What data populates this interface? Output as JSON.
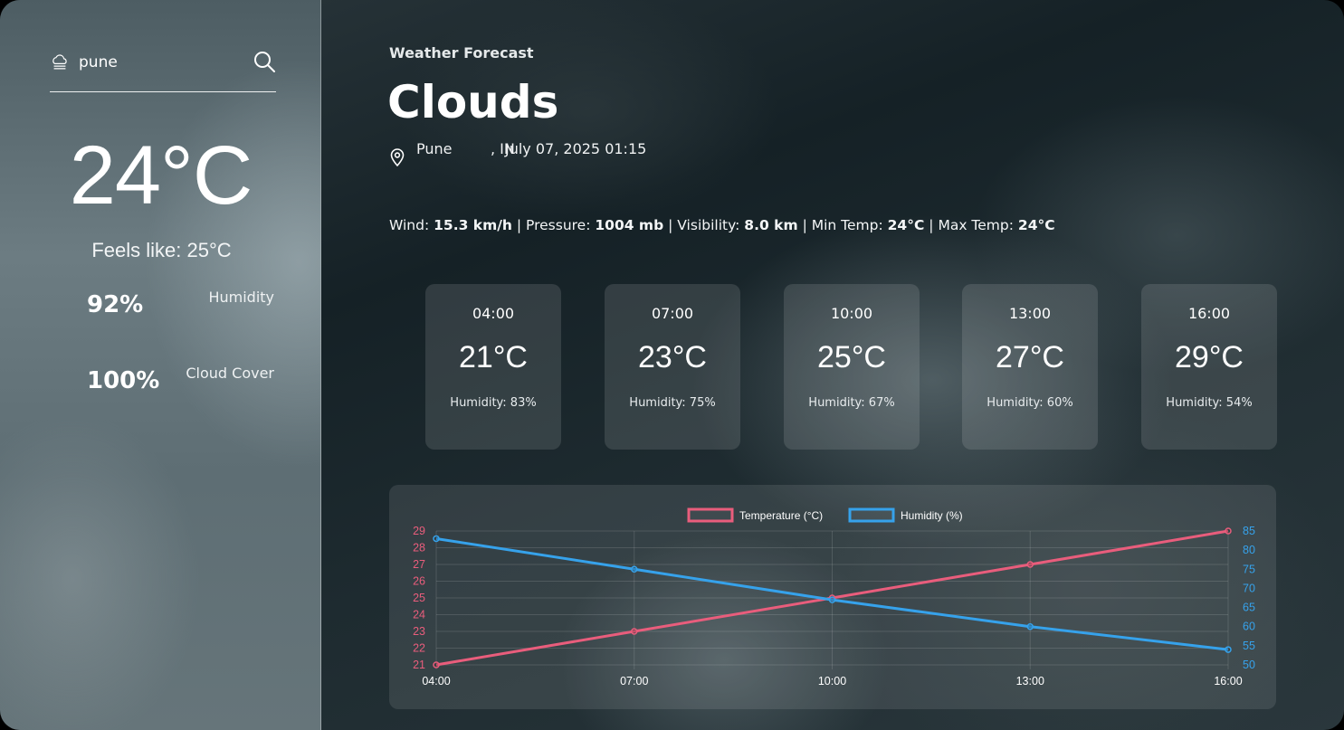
{
  "search": {
    "value": "pune",
    "icon": "cloud-icon",
    "button_icon": "search-icon"
  },
  "current": {
    "temp": "24°C",
    "feels_like": "Feels like: 25°C",
    "humidity_value": "92%",
    "humidity_label": "Humidity",
    "cloud_value": "100%",
    "cloud_label": "Cloud Cover"
  },
  "header": {
    "eyebrow": "Weather Forecast",
    "condition": "Clouds",
    "city": "Pune",
    "country": ", IN",
    "datetime": "July 07, 2025 01:15"
  },
  "details": {
    "wind_label": "Wind:",
    "wind_value": "15.3 km/h",
    "pressure_label": "Pressure:",
    "pressure_value": "1004 mb",
    "visibility_label": "Visibility:",
    "visibility_value": "8.0 km",
    "min_label": "Min Temp:",
    "min_value": "24°C",
    "max_label": "Max Temp:",
    "max_value": "24°C",
    "separator": "|"
  },
  "forecast": [
    {
      "time": "04:00",
      "temp": "21°C",
      "humidity": "Humidity: 83%"
    },
    {
      "time": "07:00",
      "temp": "23°C",
      "humidity": "Humidity: 75%"
    },
    {
      "time": "10:00",
      "temp": "25°C",
      "humidity": "Humidity: 67%"
    },
    {
      "time": "13:00",
      "temp": "27°C",
      "humidity": "Humidity: 60%"
    },
    {
      "time": "16:00",
      "temp": "29°C",
      "humidity": "Humidity: 54%"
    }
  ],
  "colors": {
    "temperature": "#e95d7c",
    "humidity": "#36a2eb"
  },
  "chart_data": {
    "type": "line",
    "categories": [
      "04:00",
      "07:00",
      "10:00",
      "13:00",
      "16:00"
    ],
    "series": [
      {
        "name": "Temperature (°C)",
        "values": [
          21,
          23,
          25,
          27,
          29
        ],
        "axis": "left"
      },
      {
        "name": "Humidity (%)",
        "values": [
          83,
          75,
          67,
          60,
          54
        ],
        "axis": "right"
      }
    ],
    "y_left": {
      "min": 21,
      "max": 29,
      "ticks": [
        21,
        22,
        23,
        24,
        25,
        26,
        27,
        28,
        29
      ]
    },
    "y_right": {
      "min": 50,
      "max": 85,
      "ticks": [
        50,
        55,
        60,
        65,
        70,
        75,
        80,
        85
      ]
    },
    "legend": "top-center",
    "grid": true
  }
}
